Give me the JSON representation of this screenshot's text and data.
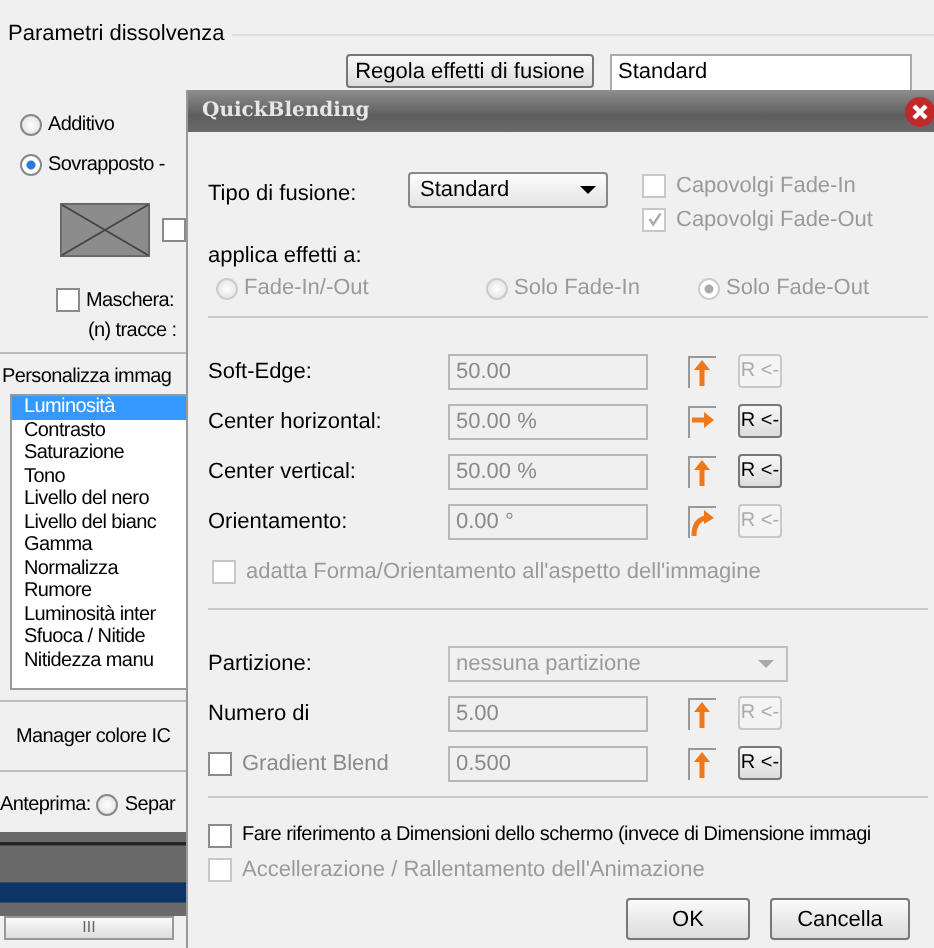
{
  "background": {
    "group_title": "Parametri dissolvenza",
    "adjust_button": "Regola effetti di fusione",
    "effect_field": "Standard",
    "blend_modes": [
      {
        "label": "Additivo",
        "selected": false
      },
      {
        "label": "Sovrapposto -",
        "selected": true
      }
    ],
    "side_checkbox": {
      "checked": false
    },
    "mask": {
      "label": "Maschera:",
      "checked": false,
      "note": "(n) tracce :"
    },
    "customize_title": "Personalizza immag",
    "adjustments": [
      {
        "label": "Luminosità",
        "selected": true
      },
      {
        "label": "Contrasto",
        "selected": false
      },
      {
        "label": "Saturazione",
        "selected": false
      },
      {
        "label": "Tono",
        "selected": false
      },
      {
        "label": "Livello del nero",
        "selected": false
      },
      {
        "label": "Livello del bianc",
        "selected": false
      },
      {
        "label": "Gamma",
        "selected": false
      },
      {
        "label": "Normalizza",
        "selected": false
      },
      {
        "label": "Rumore",
        "selected": false
      },
      {
        "label": "Luminosità inter",
        "selected": false
      },
      {
        "label": "Sfuoca / Nitide",
        "selected": false
      },
      {
        "label": "Nitidezza manu",
        "selected": false
      }
    ],
    "color_manager": "Manager colore IC",
    "preview_label": "Anteprima:",
    "preview_option": {
      "label": "Separ",
      "selected": false
    },
    "scrollbar_grip": "III"
  },
  "dialog": {
    "title": "QuickBlending",
    "blend_type_label": "Tipo di fusione:",
    "blend_type": "Standard",
    "flips": [
      {
        "label": "Capovolgi Fade-In",
        "checked": false,
        "disabled": true
      },
      {
        "label": "Capovolgi Fade-Out",
        "checked": true,
        "disabled": true
      }
    ],
    "apply_label": "applica effetti a:",
    "apply_targets": [
      {
        "label": "Fade-In/-Out",
        "selected": false
      },
      {
        "label": "Solo Fade-In",
        "selected": false
      },
      {
        "label": "Solo Fade-Out",
        "selected": true
      }
    ],
    "params": [
      {
        "label": "Soft-Edge:",
        "value": "50.00",
        "kind": "vertical",
        "reset": "R <-",
        "reset_disabled": true
      },
      {
        "label": "Center horizontal:",
        "value": "50.00 %",
        "kind": "horizontal",
        "reset": "R <-",
        "reset_disabled": false
      },
      {
        "label": "Center vertical:",
        "value": "50.00 %",
        "kind": "vertical",
        "reset": "R <-",
        "reset_disabled": false
      },
      {
        "label": "Orientamento:",
        "value": "0.00 °",
        "kind": "rotation",
        "reset": "R <-",
        "reset_disabled": true
      }
    ],
    "fit_shape": {
      "label": "adatta Forma/Orientamento all'aspetto dell'immagine",
      "checked": false
    },
    "partition_label": "Partizione:",
    "partition": "nessuna partizione",
    "count": {
      "label": "Numero di",
      "value": "5.00",
      "kind": "vertical",
      "reset": "R <-",
      "reset_disabled": true
    },
    "gradient": {
      "label": "Gradient Blend",
      "checked": false,
      "value": "0.500",
      "kind": "vertical",
      "reset": "R <-",
      "reset_disabled": false
    },
    "screen_ref": {
      "label": "Fare riferimento a Dimensioni dello schermo (invece di Dimensione immagi",
      "checked": false,
      "disabled": false
    },
    "easing": {
      "label": "Accellerazione / Rallentamento dell'Animazione",
      "checked": false,
      "disabled": true
    },
    "buttons": [
      "OK",
      "Cancella"
    ]
  }
}
